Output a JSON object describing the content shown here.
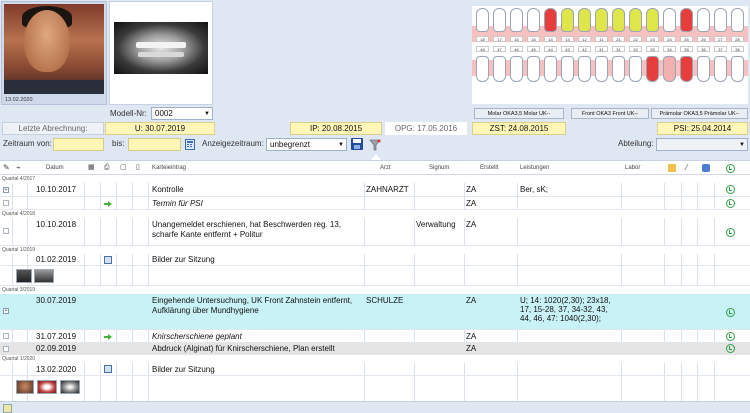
{
  "photos": {
    "patient_date": "13.02.2020"
  },
  "model": {
    "label": "Modell-Nr:",
    "value": "0002"
  },
  "teeth_upper": [
    "18",
    "17",
    "16",
    "15",
    "14",
    "13",
    "12",
    "11",
    "21",
    "22",
    "23",
    "24",
    "25",
    "26",
    "27",
    "28"
  ],
  "teeth_lower": [
    "48",
    "47",
    "46",
    "45",
    "44",
    "43",
    "42",
    "41",
    "31",
    "32",
    "33",
    "34",
    "35",
    "36",
    "37",
    "38"
  ],
  "chart_buttons": [
    "Molar OKA3,5 Molar UK--",
    "Front OKA3 Front UK--",
    "Prämolar OKA3,5 Prämolar UK--"
  ],
  "summary": {
    "last_billing": "Letzte Abrechnung:",
    "u": "U: 30.07.2019",
    "ip": "IP: 20.08.2015",
    "opg": "OPG: 17.05.2016",
    "zst": "ZST: 24.08.2015",
    "psi": "PSI: 25.04.2014"
  },
  "filters": {
    "period_from": "Zeitraum von:",
    "to": "bis:",
    "display_period": "Anzeigezeitraum:",
    "display_value": "unbegrenzt",
    "department": "Abteilung:"
  },
  "columns": {
    "date": "Datum",
    "entry": "Karteieintrag",
    "doctor": "Arzt",
    "signum": "Signum",
    "created": "Erstellt",
    "services": "Leistungen",
    "lab": "Labor"
  },
  "quarters": {
    "q4_2017": "Quartal 4/2017",
    "q4_2018": "Quartal 4/2018",
    "q1_2019": "Quartal 1/2019",
    "q3_2019": "Quartal 3/2019",
    "q1_2020": "Quartal 1/2020"
  },
  "rows": {
    "r1": {
      "date": "10.10.2017",
      "entry": "Kontrolle",
      "doctor": "ZAHNARZT",
      "created": "ZA",
      "services": "Ber, sK;"
    },
    "r2": {
      "entry": "Termin für PSI",
      "created": "ZA"
    },
    "r3": {
      "date": "10.10.2018",
      "entry1": "Unangemeldet erschienen, hat Beschwerden  reg. 13,",
      "entry2": "scharfe Kante entfernt + Politur",
      "signum": "Verwaltung",
      "created": "ZA"
    },
    "r4": {
      "date": "01.02.2019",
      "entry": "Bilder zur Sitzung"
    },
    "r5": {
      "date": "30.07.2019",
      "entry1": "Eingehende Untersuchung, UK Front Zahnstein entfernt,",
      "entry2": "Aufklärung über Mundhygiene",
      "doctor": "SCHULZE",
      "created": "ZA",
      "services1": "U; 14: 1020(2,30); 23x18,",
      "services2": "17, 15-28, 37, 34-32, 43,",
      "services3": "44, 46, 47: 1040(2,30);"
    },
    "r6": {
      "date": "31.07.2019",
      "entry": "Knirscherschiene geplant",
      "created": "ZA"
    },
    "r7": {
      "date": "02.09.2019",
      "entry": "Abdruck (Alginat) für Knirscherschiene, Plan erstellt",
      "created": "ZA"
    },
    "r8": {
      "date": "13.02.2020",
      "entry": "Bilder zur Sitzung"
    }
  },
  "colors": {
    "highlight_row": "#c9f2f6",
    "grey_row": "#e4e4e4",
    "summary_yellow": "#fff6b8",
    "tooth_red": "#e63d3d"
  }
}
